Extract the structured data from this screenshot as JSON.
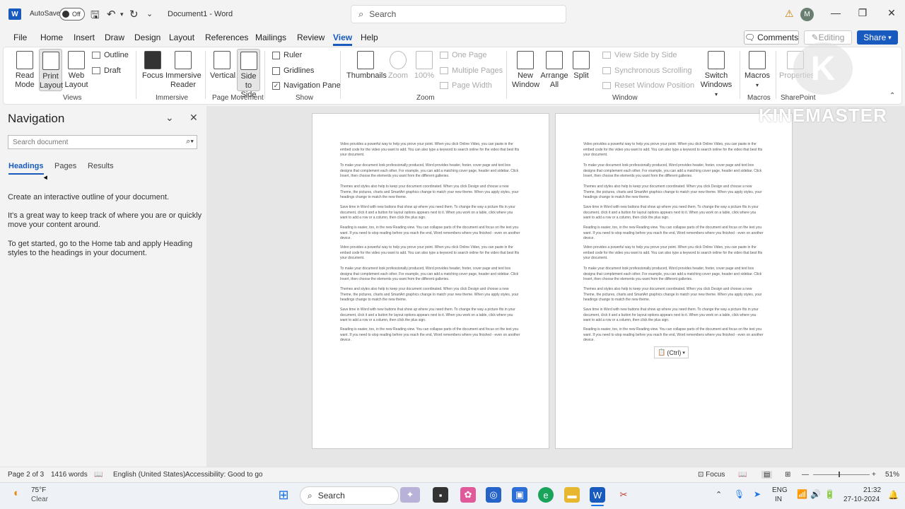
{
  "app": {
    "autosave_label": "AutoSave",
    "autosave_state": "Off",
    "doc_title": "Document1 - Word",
    "search_placeholder": "Search",
    "avatar_initial": "M"
  },
  "menu": [
    "File",
    "Home",
    "Insert",
    "Draw",
    "Design",
    "Layout",
    "References",
    "Mailings",
    "Review",
    "View",
    "Help"
  ],
  "menu_active": "View",
  "topright": {
    "comments": "Comments",
    "editing": "Editing",
    "share": "Share"
  },
  "ribbon": {
    "views": {
      "read_mode": "Read Mode",
      "print_layout": "Print Layout",
      "web_layout": "Web Layout",
      "outline": "Outline",
      "draft": "Draft",
      "label": "Views"
    },
    "immersive": {
      "focus": "Focus",
      "immersive_reader": "Immersive Reader",
      "label": "Immersive"
    },
    "page_movement": {
      "vertical": "Vertical",
      "side_to_side": "Side to Side",
      "label": "Page Movement"
    },
    "show": {
      "ruler": "Ruler",
      "gridlines": "Gridlines",
      "navigation_pane": "Navigation Pane",
      "label": "Show"
    },
    "zoom": {
      "thumbnails": "Thumbnails",
      "zoom": "Zoom",
      "hundred": "100%",
      "one_page": "One Page",
      "multiple_pages": "Multiple Pages",
      "page_width": "Page Width",
      "label": "Zoom"
    },
    "window": {
      "new_window": "New Window",
      "arrange_all": "Arrange All",
      "split": "Split",
      "view_side_by_side": "View Side by Side",
      "sync_scrolling": "Synchronous Scrolling",
      "reset_position": "Reset Window Position",
      "switch_windows": "Switch Windows",
      "label": "Window"
    },
    "macros": {
      "macros": "Macros",
      "label": "Macros"
    },
    "sharepoint": {
      "properties": "Properties",
      "label": "SharePoint"
    }
  },
  "navigation": {
    "title": "Navigation",
    "search_placeholder": "Search document",
    "tabs": [
      "Headings",
      "Pages",
      "Results"
    ],
    "active_tab": "Headings",
    "text1": "Create an interactive outline of your document.",
    "text2": "It's a great way to keep track of where you are or quickly move your content around.",
    "text3": "To get started, go to the Home tab and apply Heading styles to the headings in your document."
  },
  "document": {
    "paragraphs": [
      "Video provides a powerful way to help you prove your point. When you click Online Video, you can paste in the embed code for the video you want to add. You can also type a keyword to search online for the video that best fits your document.",
      "To make your document look professionally produced, Word provides header, footer, cover page and text box designs that complement each other. For example, you can add a matching cover page, header and sidebar. Click Insert, then choose the elements you want from the different galleries.",
      "Themes and styles also help to keep your document coordinated. When you click Design and choose a new Theme, the pictures, charts and SmartArt graphics change to match your new theme. When you apply styles, your headings change to match the new theme.",
      "Save time in Word with new buttons that show up where you need them. To change the way a picture fits in your document, click it and a button for layout options appears next to it. When you work on a table, click where you want to add a row or a column, then click the plus sign.",
      "Reading is easier, too, in the new Reading view. You can collapse parts of the document and focus on the text you want. If you need to stop reading before you reach the end, Word remembers where you finished - even on another device."
    ],
    "paste_tag": "(Ctrl)"
  },
  "watermark": {
    "text": "KINEMASTER",
    "letter": "K"
  },
  "status": {
    "page": "Page 2 of 3",
    "words": "1416 words",
    "language": "English (United States)",
    "accessibility": "Accessibility: Good to go",
    "focus": "Focus",
    "zoom": "51%"
  },
  "taskbar": {
    "weather_temp": "75°F",
    "weather_desc": "Clear",
    "search": "Search",
    "lang1": "ENG",
    "lang2": "IN",
    "time": "21:32",
    "date": "27-10-2024"
  }
}
